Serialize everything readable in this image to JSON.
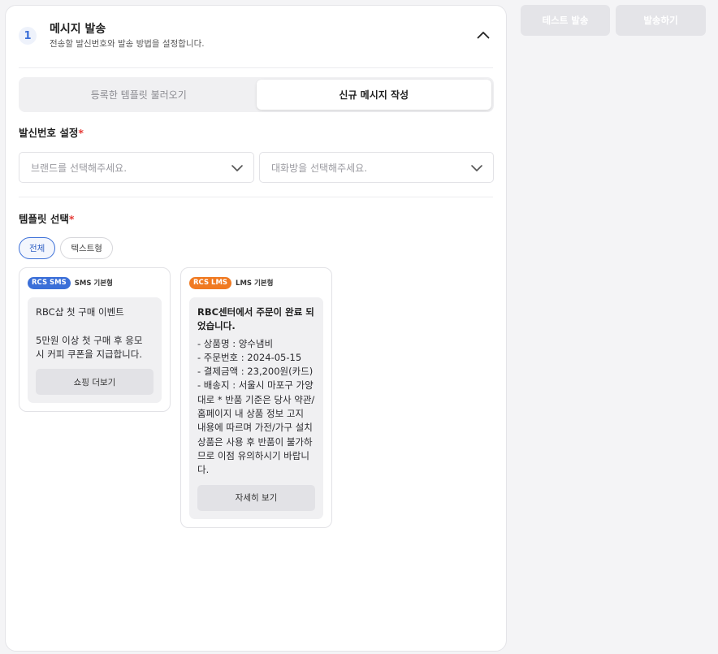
{
  "step": {
    "number": "1",
    "title": "메시지 발송",
    "description": "전송할 발신번호와 발송 방법을 설정합니다."
  },
  "segment": {
    "options": [
      "등록한 템플릿 불러오기",
      "신규 메시지 작성"
    ],
    "active": "신규 메시지 작성"
  },
  "sender": {
    "label": "발신번호 설정",
    "brand_placeholder": "브랜드를 선택해주세요.",
    "chatroom_placeholder": "대화방을 선택해주세요."
  },
  "template": {
    "label": "템플릿 선택",
    "filters": [
      "전체",
      "텍스트형"
    ],
    "active_filter": "전체",
    "cards": [
      {
        "badge": "RCS SMS",
        "type": "SMS 기본형",
        "body": "RBC샵 첫 구매 이벤트\n\n5만원 이상 첫 구매 후 응모 시 커피 쿠폰을 지급합니다.",
        "button": "쇼핑 더보기"
      },
      {
        "badge": "RCS LMS",
        "type": "LMS 기본형",
        "title": "RBC센터에서 주문이 완료 되었습니다.",
        "body": "- 상품명 : 양수냄비\n- 주문번호 : 2024-05-15\n- 결제금액 : 23,200원(카드)\n- 배송지 : 서울시 마포구 가양대로 * 반품 기준은 당사 약관/홈페이지 내 상품 정보 고지 내용에 따르며 가전/가구 설치상품은 사용 후 반품이 불가하므로 이점 유의하시기 바랍니다.",
        "button": "자세히 보기"
      }
    ]
  },
  "actions": {
    "test_send": "테스트 발송",
    "send": "발송하기"
  },
  "colors": {
    "accent": "#3b6fd8",
    "sms_badge": "#3b6fd8",
    "lms_badge": "#f07a22",
    "required": "#e53935",
    "disabled_button": "#e4e4e8"
  },
  "icons": {
    "collapse": "chevron-up-icon",
    "dropdown": "chevron-down-icon"
  }
}
